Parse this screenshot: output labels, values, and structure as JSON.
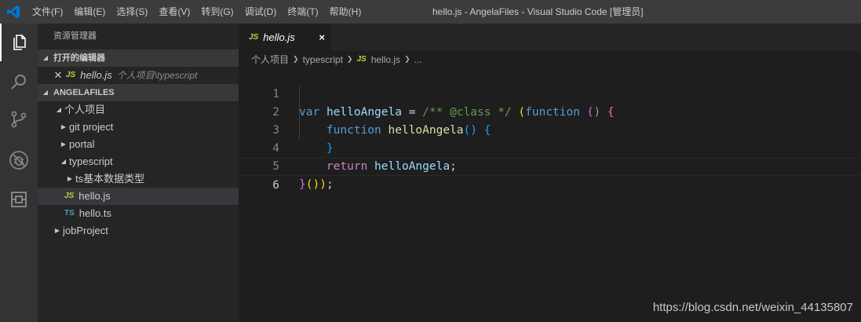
{
  "titlebar": {
    "menu": [
      "文件(F)",
      "编辑(E)",
      "选择(S)",
      "查看(V)",
      "转到(G)",
      "调试(D)",
      "终端(T)",
      "帮助(H)"
    ],
    "window_title": "hello.js - AngelaFiles - Visual Studio Code [管理员]"
  },
  "activitybar": {
    "items": [
      "explorer-icon",
      "search-icon",
      "source-control-icon",
      "debug-icon",
      "extensions-icon"
    ]
  },
  "sidebar": {
    "title": "资源管理器",
    "open_editors": {
      "header": "打开的编辑器",
      "items": [
        {
          "badge": "JS",
          "name": "hello.js",
          "path": "个人项目\\typescript"
        }
      ]
    },
    "folder": {
      "header": "ANGELAFILES",
      "tree": [
        {
          "label": "个人项目",
          "depth": 0,
          "expanded": true
        },
        {
          "label": "git project",
          "depth": 1,
          "expanded": false
        },
        {
          "label": "portal",
          "depth": 1,
          "expanded": false
        },
        {
          "label": "typescript",
          "depth": 1,
          "expanded": true
        },
        {
          "label": "ts基本数据类型",
          "depth": 2,
          "expanded": false
        },
        {
          "label": "hello.js",
          "badge": "JS",
          "depth": 2,
          "selected": true
        },
        {
          "label": "hello.ts",
          "badge": "TS",
          "depth": 2
        },
        {
          "label": "jobProject",
          "depth": 0,
          "expanded": false
        }
      ]
    }
  },
  "editor": {
    "tab": {
      "badge": "JS",
      "label": "hello.js",
      "close": "×"
    },
    "breadcrumb": [
      "个人项目",
      "typescript",
      "hello.js",
      "..."
    ],
    "breadcrumb_badge": "JS",
    "lines": [
      {
        "n": "1"
      },
      {
        "n": "2"
      },
      {
        "n": "3"
      },
      {
        "n": "4"
      },
      {
        "n": "5"
      },
      {
        "n": "6"
      }
    ],
    "code": {
      "var_kw": "var",
      "name": "helloAngela",
      "eq": " = ",
      "comment": "/** @class */",
      "paren_open": "(",
      "function_kw": "function",
      "empty_parens": "()",
      "brace_open": "{",
      "inner_fn_kw": "function",
      "inner_name": "helloAngela",
      "inner_parens": "()",
      "inner_brace": "{",
      "close_brace": "}",
      "return_kw": "return",
      "return_name": "helloAngela",
      "semicolon": ";",
      "outer_close": "}",
      "call_parens": "())",
      "end": ";"
    }
  },
  "watermark": "https://blog.csdn.net/weixin_44135807",
  "colors": {
    "titlebar": "#3c3c3c",
    "activitybar": "#333333",
    "sidebar": "#252526",
    "editor": "#1e1e1e",
    "vscode_blue": "#0078d4"
  }
}
